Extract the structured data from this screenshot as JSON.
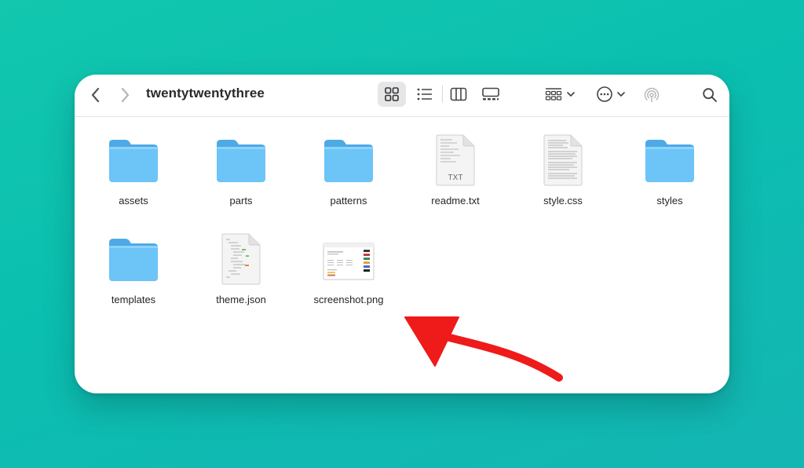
{
  "window": {
    "title": "twentytwentythree"
  },
  "toolbar": {
    "back_icon": "chevron-left-icon",
    "forward_icon": "chevron-right-icon",
    "views": [
      "icon-view-icon",
      "list-view-icon",
      "column-view-icon",
      "gallery-view-icon"
    ],
    "selected_view": "icon-view-icon",
    "group_icon": "group-by-icon",
    "actions_icon": "ellipsis-circle-icon",
    "airdrop_icon": "airdrop-icon",
    "search_icon": "search-icon"
  },
  "files": [
    {
      "name": "assets",
      "kind": "folder"
    },
    {
      "name": "parts",
      "kind": "folder"
    },
    {
      "name": "patterns",
      "kind": "folder"
    },
    {
      "name": "readme.txt",
      "kind": "document",
      "badge": "TXT"
    },
    {
      "name": "style.css",
      "kind": "document"
    },
    {
      "name": "styles",
      "kind": "folder"
    },
    {
      "name": "templates",
      "kind": "folder"
    },
    {
      "name": "theme.json",
      "kind": "document"
    },
    {
      "name": "screenshot.png",
      "kind": "image"
    }
  ],
  "colors": {
    "background": "#12c7ae",
    "folder": "#6cc4f7",
    "folder_tab": "#4ea9e6",
    "arrow": "#ef1a1a"
  }
}
